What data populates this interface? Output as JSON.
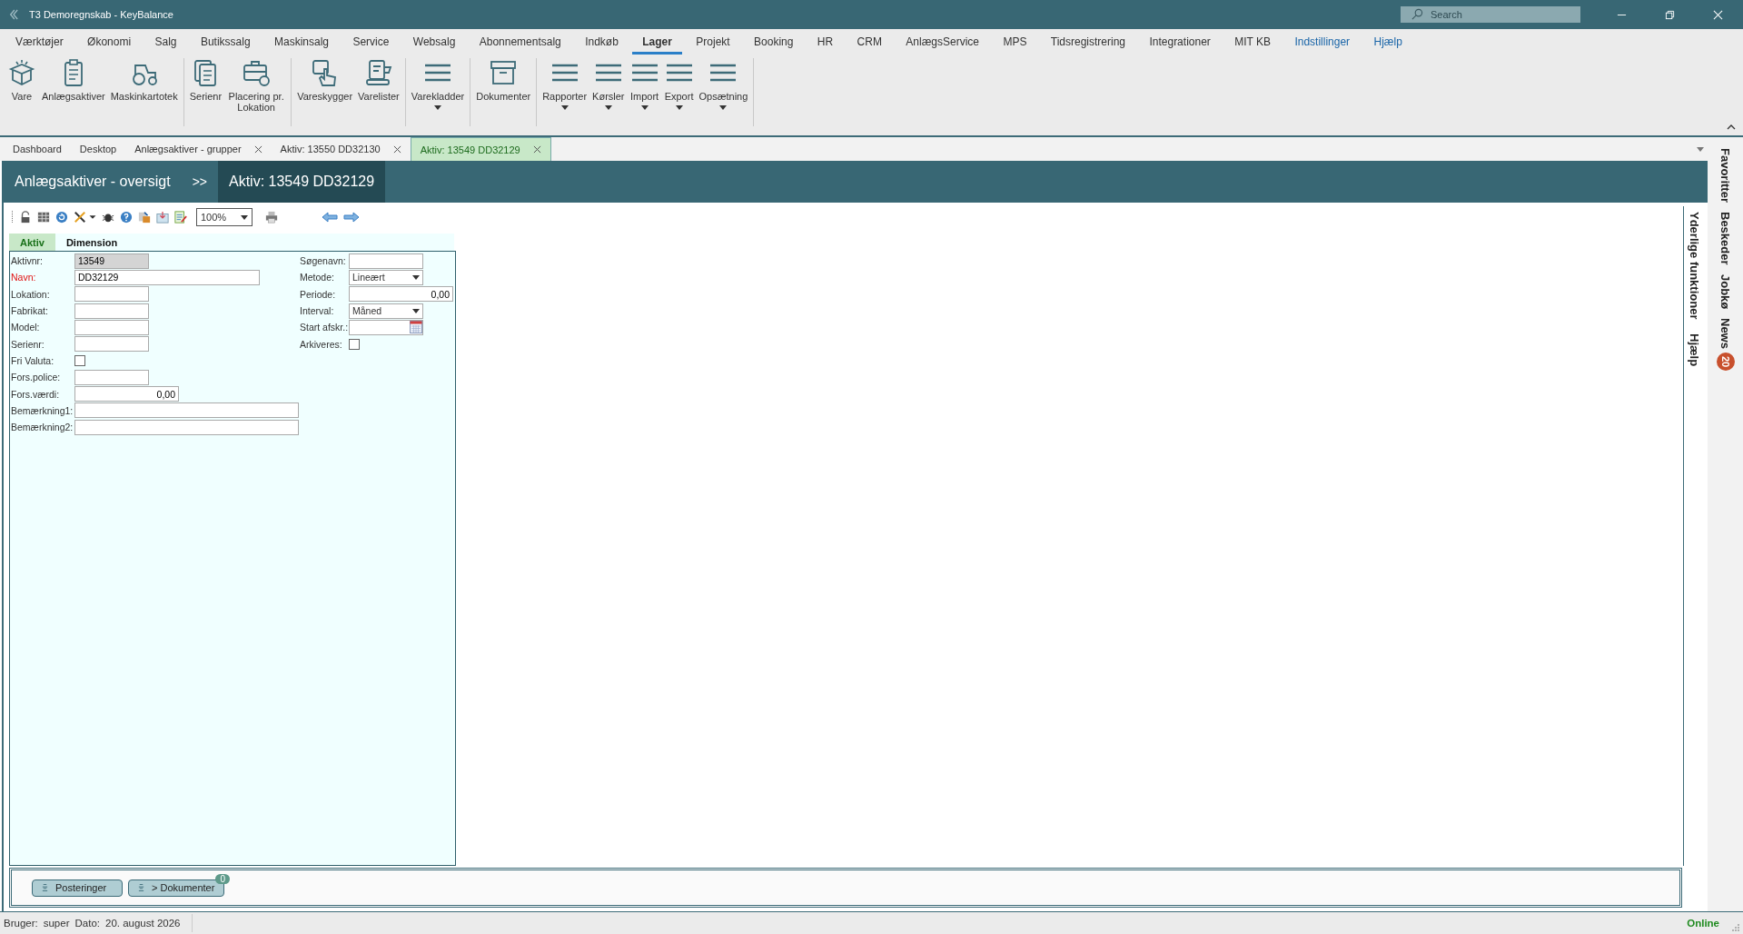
{
  "window": {
    "title": "T3 Demoregnskab - KeyBalance",
    "search_placeholder": "Search"
  },
  "menu": [
    {
      "label": "Værktøjer",
      "selected": false,
      "kind": "menu"
    },
    {
      "label": "Økonomi",
      "selected": false,
      "kind": "menu"
    },
    {
      "label": "Salg",
      "selected": false,
      "kind": "menu"
    },
    {
      "label": "Butikssalg",
      "selected": false,
      "kind": "menu"
    },
    {
      "label": "Maskinsalg",
      "selected": false,
      "kind": "menu"
    },
    {
      "label": "Service",
      "selected": false,
      "kind": "menu"
    },
    {
      "label": "Websalg",
      "selected": false,
      "kind": "menu"
    },
    {
      "label": "Abonnementsalg",
      "selected": false,
      "kind": "menu"
    },
    {
      "label": "Indkøb",
      "selected": false,
      "kind": "menu"
    },
    {
      "label": "Lager",
      "selected": true,
      "kind": "menu"
    },
    {
      "label": "Projekt",
      "selected": false,
      "kind": "menu"
    },
    {
      "label": "Booking",
      "selected": false,
      "kind": "menu"
    },
    {
      "label": "HR",
      "selected": false,
      "kind": "menu"
    },
    {
      "label": "CRM",
      "selected": false,
      "kind": "menu"
    },
    {
      "label": "AnlægsService",
      "selected": false,
      "kind": "menu"
    },
    {
      "label": "MPS",
      "selected": false,
      "kind": "menu"
    },
    {
      "label": "Tidsregistrering",
      "selected": false,
      "kind": "menu"
    },
    {
      "label": "Integrationer",
      "selected": false,
      "kind": "menu"
    },
    {
      "label": "MIT KB",
      "selected": false,
      "kind": "menu"
    },
    {
      "label": "Indstillinger",
      "selected": false,
      "kind": "link"
    },
    {
      "label": "Hjælp",
      "selected": false,
      "kind": "link"
    }
  ],
  "ribbon": [
    [
      {
        "label": "Vare",
        "dropdown": false
      },
      {
        "label": "Anlægsaktiver",
        "dropdown": false
      },
      {
        "label": "Maskinkartotek",
        "dropdown": false
      }
    ],
    [
      {
        "label": "Serienr",
        "dropdown": false
      },
      {
        "label": "Placering pr. Lokation",
        "dropdown": false
      }
    ],
    [
      {
        "label": "Vareskygger",
        "dropdown": false
      },
      {
        "label": "Varelister",
        "dropdown": false
      }
    ],
    [
      {
        "label": "Varekladder",
        "dropdown": true
      }
    ],
    [
      {
        "label": "Dokumenter",
        "dropdown": false
      }
    ],
    [
      {
        "label": "Rapporter",
        "dropdown": true
      },
      {
        "label": "Kørsler",
        "dropdown": true
      },
      {
        "label": "Import",
        "dropdown": true
      },
      {
        "label": "Export",
        "dropdown": true
      },
      {
        "label": "Opsætning",
        "dropdown": true
      }
    ]
  ],
  "doc_tabs": [
    {
      "label": "Dashboard",
      "closable": false,
      "selected": false
    },
    {
      "label": "Desktop",
      "closable": false,
      "selected": false
    },
    {
      "label": "Anlægsaktiver - grupper",
      "closable": true,
      "selected": false
    },
    {
      "label": "Aktiv: 13550 DD32130",
      "closable": true,
      "selected": false
    },
    {
      "label": "Aktiv: 13549 DD32129",
      "closable": true,
      "selected": true
    }
  ],
  "breadcrumb": {
    "parent": "Anlægsaktiver - oversigt",
    "separator": ">>",
    "current": "Aktiv: 13549 DD32129"
  },
  "toolbar": {
    "zoom": "100%"
  },
  "form_tabs": [
    {
      "label": "Aktiv",
      "selected": true
    },
    {
      "label": "Dimension",
      "selected": false
    }
  ],
  "fields_left": [
    {
      "label": "Aktivnr:",
      "kind": "text",
      "value": "13549",
      "readonly": true,
      "required": false
    },
    {
      "label": "Navn:",
      "kind": "text",
      "value": "DD32129",
      "readonly": false,
      "required": true
    },
    {
      "label": "Lokation:",
      "kind": "text",
      "readonly": false,
      "required": false
    },
    {
      "label": "Fabrikat:",
      "kind": "text",
      "readonly": false,
      "required": false
    },
    {
      "label": "Model:",
      "kind": "text",
      "readonly": false,
      "required": false
    },
    {
      "label": "Serienr:",
      "kind": "text",
      "readonly": false,
      "required": false
    },
    {
      "label": "Fri Valuta:",
      "kind": "checkbox",
      "checked": false,
      "readonly": false,
      "required": false
    },
    {
      "label": "Fors.police:",
      "kind": "text",
      "readonly": false,
      "required": false
    },
    {
      "label": "Fors.værdi:",
      "kind": "number",
      "value": "0,00",
      "readonly": false,
      "required": false
    },
    {
      "label": "Bemærkning1:",
      "kind": "text",
      "readonly": false,
      "required": false
    },
    {
      "label": "Bemærkning2:",
      "kind": "text",
      "readonly": false,
      "required": false
    }
  ],
  "fields_right": [
    {
      "label": "Søgenavn:",
      "kind": "text",
      "readonly": false,
      "required": false
    },
    {
      "label": "Metode:",
      "kind": "select",
      "value": "Lineært",
      "readonly": false,
      "required": false
    },
    {
      "label": "Periode:",
      "kind": "number",
      "value": "0,00",
      "readonly": false,
      "required": false
    },
    {
      "label": "Interval:",
      "kind": "select",
      "value": "Måned",
      "readonly": false,
      "required": false
    },
    {
      "label": "Start afskr.:",
      "kind": "date",
      "readonly": false,
      "required": false
    },
    {
      "label": "Arkiveres:",
      "kind": "checkbox",
      "checked": false,
      "readonly": false,
      "required": false
    }
  ],
  "side_links": [
    "Yderlige funktioner",
    "Hjælp"
  ],
  "bottom_buttons": [
    {
      "label": "Posteringer"
    },
    {
      "label": "> Dokumenter",
      "badge": "0"
    }
  ],
  "sidebar": [
    {
      "label": "Favoritter"
    },
    {
      "label": "Beskeder"
    },
    {
      "label": "Jobkø"
    },
    {
      "label": "News",
      "badge": "20"
    }
  ],
  "status_bar": {
    "user_label": "Bruger:",
    "user": "super",
    "date_label": "Dato:",
    "date": "20. august 2026",
    "connection": "Online"
  }
}
